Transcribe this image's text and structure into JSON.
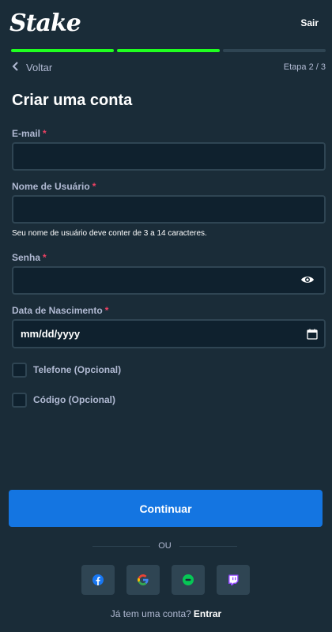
{
  "header": {
    "logo_text": "Stake",
    "exit_label": "Sair"
  },
  "progress": {
    "total_steps": 3,
    "completed_steps": 2,
    "accent_color": "#1fff20"
  },
  "nav": {
    "back_label": "Voltar",
    "step_text": "Etapa 2 / 3"
  },
  "form": {
    "title": "Criar uma conta",
    "required_marker": "*",
    "email": {
      "label": "E-mail",
      "value": ""
    },
    "username": {
      "label": "Nome de Usuário",
      "value": "",
      "hint": "Seu nome de usuário deve conter de 3 a 14 caracteres."
    },
    "password": {
      "label": "Senha",
      "value": ""
    },
    "birthdate": {
      "label": "Data de Nascimento",
      "value": "mm/dd/yyyy"
    },
    "phone_option": {
      "label": "Telefone (Opcional)",
      "checked": false
    },
    "code_option": {
      "label": "Código (Opcional)",
      "checked": false
    }
  },
  "actions": {
    "continue_label": "Continuar",
    "divider_label": "OU",
    "primary_color": "#1475e1"
  },
  "social": [
    {
      "name": "facebook-icon"
    },
    {
      "name": "google-icon"
    },
    {
      "name": "line-icon"
    },
    {
      "name": "twitch-icon"
    }
  ],
  "footer": {
    "question": "Já tem uma conta?",
    "login_label": "Entrar"
  }
}
